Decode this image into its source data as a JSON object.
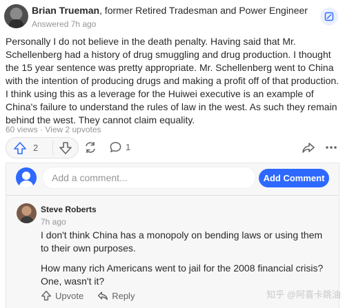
{
  "answer": {
    "author_name": "Brian Trueman",
    "author_credential": ", former Retired Tradesman and Power Engineer",
    "answered_time": "Answered 7h ago",
    "body": "Personally I do not believe in the death penalty. Having said that Mr. Schellenberg had a history of drug smuggling and drug production. I thought the 15 year sentence was pretty appropriate. Mr. Schellenberg went to China with the intention of producing drugs and making a profit off of that production. I think using this as a leverage for the Huiwei executive is an example of China's failure to understand the rules of law in the west. As such they remain behind the west. They cannot claim equality.",
    "views": "60 views",
    "separator": " · ",
    "upvotes_link": "View 2 upvotes",
    "upvote_count": "2",
    "comment_count": "1"
  },
  "comment_box": {
    "placeholder": "Add a comment...",
    "submit_label": "Add Comment"
  },
  "comment": {
    "author": "Steve Roberts",
    "time": "7h ago",
    "paragraphs": [
      "I don't think China has a monopoly on bending laws or using them to their own purposes.",
      "How many rich Americans went to jail for the 2008 financial crisis? One, wasn't it?"
    ],
    "upvote_label": "Upvote",
    "reply_label": "Reply"
  },
  "watermark": "知乎 @阿喜卡跳油",
  "colors": {
    "accent": "#2e69ff",
    "text": "#282829",
    "muted": "#939598"
  },
  "icons": [
    "edit-icon",
    "upvote-icon",
    "downvote-icon",
    "share-icon",
    "comment-icon",
    "forward-icon",
    "more-icon",
    "reply-icon"
  ]
}
